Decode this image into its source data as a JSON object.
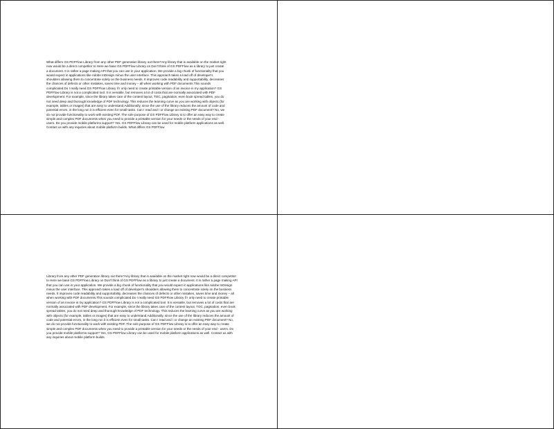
{
  "pages": [
    {
      "text": "What differs GS PDFFlow Library from any other PDF generation library out there?Any library that is available on the market right now would be a direct competitor to Here we base GS PDFFlow Library on Don't think of GS PDFFlow as a library to just create a document. It is rather a page making API that you can use in your application. We provide a big chunk of functionality that you would expect in applications like Adobe InDesign minus the user interface. This approach takes a load off of developer's shoulders allowing them to concentrate solely on the business needs. It improves code readability and supportability, decreases the chances of defects or other mistakes, saves time and money – all when working with PDF documents.This sounds complicated.Do I really need GS PDFFlow Library if I only need to create printable version of an invoice in my application? GS PDFFlow Library is not a complicated tool. It is versatile, but removes a lot of costs that are normally associated with PDF development. For example, since the library takes care of the content layout, TOC, pagination, even book spread tables, you do not need deep and thorough knowledge of PDF technology. This reduces the learning curve as you are working with objects (for example, tables or images) that are easy to understand.Additionally, since the use of the library reduces the amount of code and potential errors, in the long run it is efficient even for small tasks. Can I read and / or change an existing PDF document? No, we do not provide functionality to work with existing PDF. The sole purpose of GS PDFFlow Library is to offer an easy way to create simple and complex PDF documents when you need to provide a printable version for your needs or the needs of your end - users. Do you provide mobile platforms support? Yes, GS PDFFlow Library can be used for mobile platform applications as well. Contact us with any inquiries about mobile platform builds. What differs GS PDFFlow"
    },
    {
      "text": ""
    },
    {
      "text": "Library from any other PDF generation library out there?Any library that is available on the market right now would be a direct competitor to Here we base GS PDFFlow Library on Don't think of GS PDFFlow as a library to just create a document. It is rather a page making API that you can use in your application. We provide a big chunk of functionality that you would expect in applications like Adobe InDesign minus the user interface. This approach takes a load off of developer's shoulders allowing them to concentrate solely on the business needs. It improves code readability and supportability, decreases the chances of defects or other mistakes, saves time and money – all when working with PDF documents.This sounds complicated.Do I really need GS PDFFlow Library if I only need to create printable version of an invoice in my application? GS PDFFlow Library is not a complicated tool. It is versatile, but removes a lot of costs that are normally associated with PDF development. For example, since the library takes care of the content layout, TOC, pagination, even book spread tables, you do not need deep and thorough knowledge of PDF technology. This reduces the learning curve as you are working with objects (for example, tables or images) that are easy to understand.Additionally, since the use of the library reduces the amount of code and potential errors, in the long run it is efficient even for small tasks. Can I read and / or change an existing PDF document? No, we do not provide functionality to work with existing PDF. The sole purpose of GS PDFFlow Library is to offer an easy way to create simple and complex PDF documents when you need to provide a printable version for your needs or the needs of your end - users. Do you provide mobile platforms support? Yes, GS PDFFlow Library can be used for mobile platform applications as well. Contact us with any inquiries about mobile platform builds."
    },
    {
      "text": ""
    }
  ]
}
